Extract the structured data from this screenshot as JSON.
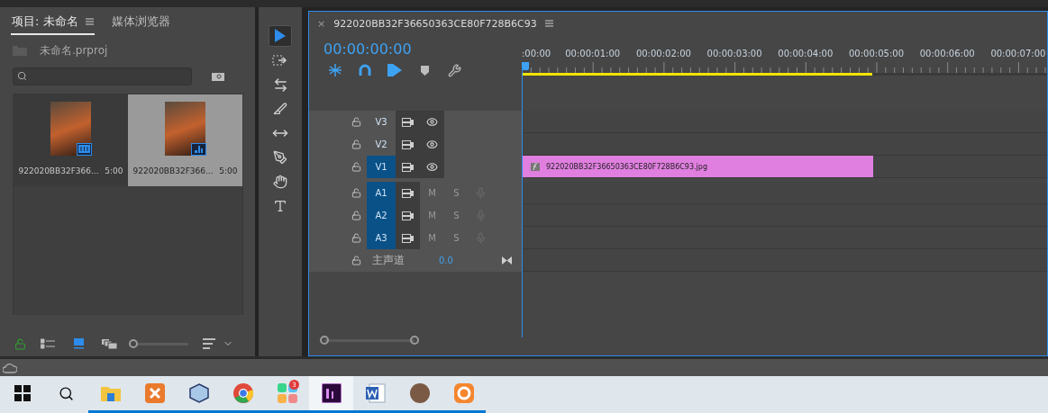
{
  "project_panel": {
    "tabs": [
      {
        "label": "项目: 未命名",
        "selected": true
      },
      {
        "label": "媒体浏览器",
        "selected": false
      }
    ],
    "project_file": "未命名.prproj",
    "items": [
      {
        "name": "922020BB32F366...",
        "duration": "5:00",
        "kind": "clip",
        "selected": false
      },
      {
        "name": "922020BB32F366...",
        "duration": "5:00",
        "kind": "sequence",
        "selected": true
      }
    ],
    "view_buttons": [
      {
        "kind": "list",
        "selected": false
      },
      {
        "kind": "icon",
        "selected": true
      },
      {
        "kind": "freeform",
        "selected": false
      }
    ],
    "thumbnail_zoom": {
      "level": 0
    }
  },
  "tools": [
    {
      "kind": "selection",
      "selected": true
    },
    {
      "kind": "track-select",
      "selected": false
    },
    {
      "kind": "ripple",
      "selected": false
    },
    {
      "kind": "razor",
      "selected": false
    },
    {
      "kind": "slip",
      "selected": false
    },
    {
      "kind": "pen",
      "selected": false
    },
    {
      "kind": "hand",
      "selected": false
    },
    {
      "kind": "type",
      "selected": false
    }
  ],
  "timeline": {
    "close_label": "×",
    "title": "922020BB32F36650363CE80F728B6C93",
    "timecode": "00:00:00:00",
    "controls": [
      {
        "kind": "nest",
        "on": true
      },
      {
        "kind": "snap",
        "on": true
      },
      {
        "kind": "linked",
        "on": true
      },
      {
        "kind": "marker",
        "on": false
      },
      {
        "kind": "settings",
        "on": false
      }
    ],
    "ruler": {
      "labels": [
        ":00:00",
        "00:00:01:00",
        "00:00:02:00",
        "00:00:03:00",
        "00:00:04:00",
        "00:00:05:00",
        "00:00:06:00",
        "00:00:07:00"
      ],
      "work_area": {
        "level": 0.667
      }
    },
    "tracks": [
      {
        "label": "V3",
        "kind": "video",
        "targeted": false
      },
      {
        "label": "V2",
        "kind": "video",
        "targeted": false
      },
      {
        "label": "V1",
        "kind": "video",
        "targeted": true,
        "clip": {
          "name": "922020BB32F36650363CE80F728B6C93.jpg"
        }
      },
      {
        "label": "A1",
        "kind": "audio",
        "targeted": true,
        "mute": "M",
        "solo": "S"
      },
      {
        "label": "A2",
        "kind": "audio",
        "targeted": true,
        "mute": "M",
        "solo": "S"
      },
      {
        "label": "A3",
        "kind": "audio",
        "targeted": true,
        "mute": "M",
        "solo": "S"
      }
    ],
    "master": {
      "label": "主声道",
      "value": "0.0"
    }
  },
  "taskbar": {
    "apps": [
      {
        "kind": "folder",
        "active": false
      },
      {
        "kind": "xampp",
        "active": false
      },
      {
        "kind": "cube",
        "active": false
      },
      {
        "kind": "browser",
        "active": false
      },
      {
        "kind": "tiles",
        "active": false,
        "badge": "3"
      },
      {
        "kind": "premiere",
        "active": true
      },
      {
        "kind": "word",
        "active": false
      },
      {
        "kind": "avatar",
        "active": false
      },
      {
        "kind": "ring",
        "active": false
      }
    ]
  }
}
